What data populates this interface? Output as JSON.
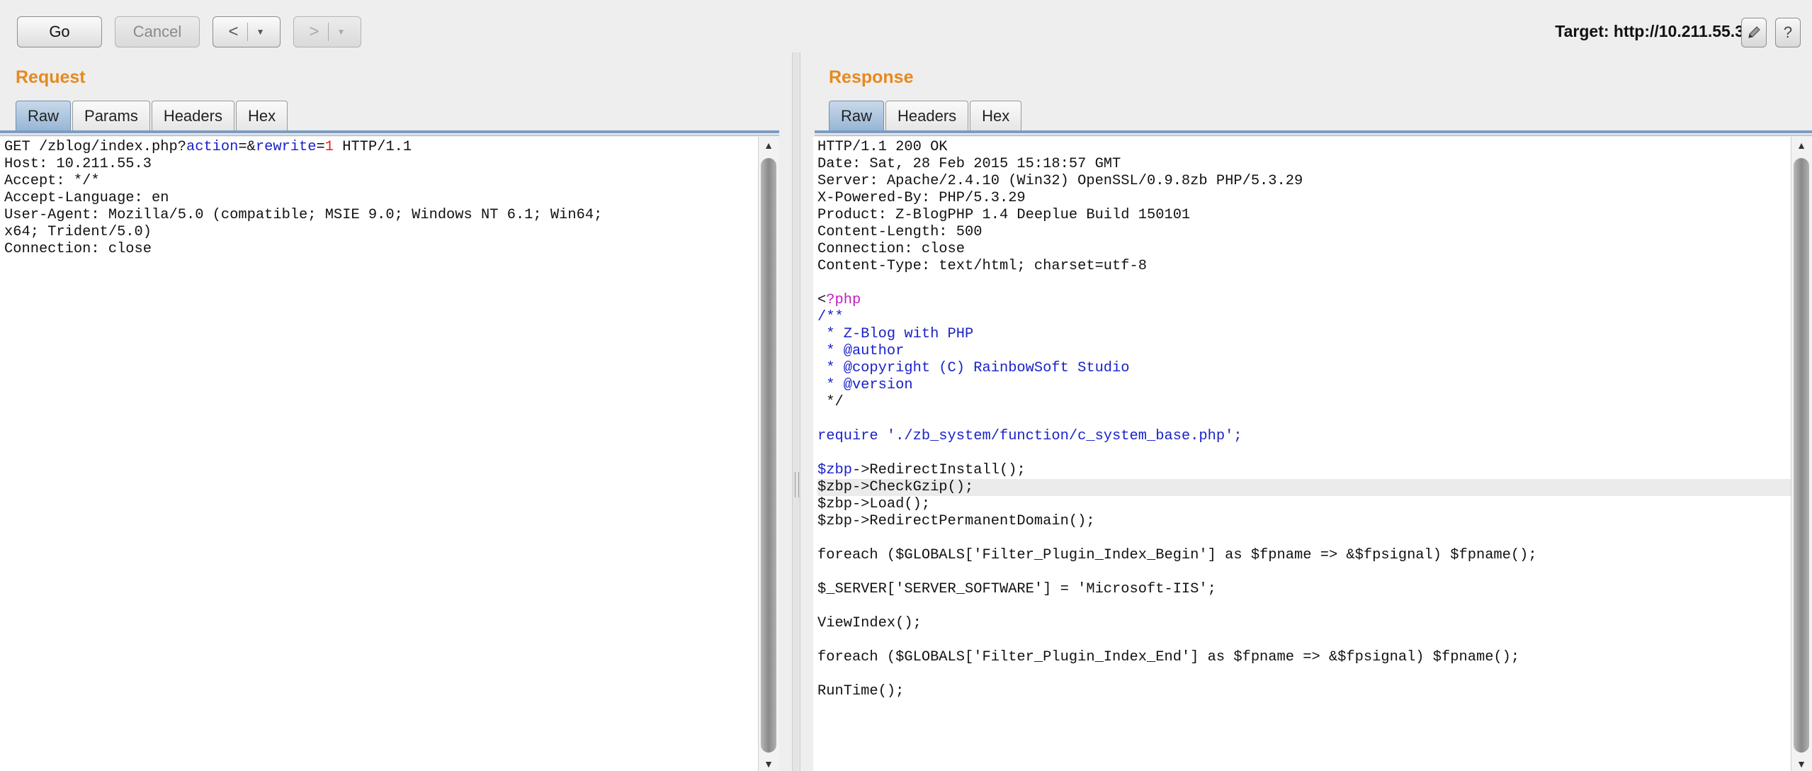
{
  "toolbar": {
    "go_label": "Go",
    "cancel_label": "Cancel",
    "back_arrow": "<",
    "forward_arrow": ">",
    "dropdown_caret": "▼",
    "target_text": "Target: http://10.211.55.3",
    "edit_icon": "pencil-icon",
    "help_label": "?"
  },
  "request": {
    "title": "Request",
    "tabs": [
      "Raw",
      "Params",
      "Headers",
      "Hex"
    ],
    "active_tab": "Raw",
    "lines": [
      [
        {
          "t": "GET /zblog/index.php?"
        },
        {
          "t": "action",
          "c": "kw-blue"
        },
        {
          "t": "=&"
        },
        {
          "t": "rewrite",
          "c": "kw-blue"
        },
        {
          "t": "="
        },
        {
          "t": "1",
          "c": "kw-red"
        },
        {
          "t": " HTTP/1.1"
        }
      ],
      [
        {
          "t": "Host: 10.211.55.3"
        }
      ],
      [
        {
          "t": "Accept: */*"
        }
      ],
      [
        {
          "t": "Accept-Language: en"
        }
      ],
      [
        {
          "t": "User-Agent: Mozilla/5.0 (compatible; MSIE 9.0; Windows NT 6.1; Win64;"
        }
      ],
      [
        {
          "t": "x64; Trident/5.0)"
        }
      ],
      [
        {
          "t": "Connection: close"
        }
      ]
    ]
  },
  "response": {
    "title": "Response",
    "tabs": [
      "Raw",
      "Headers",
      "Hex"
    ],
    "active_tab": "Raw",
    "highlight_line": 20,
    "lines": [
      [
        {
          "t": "HTTP/1.1 200 OK"
        }
      ],
      [
        {
          "t": "Date: Sat, 28 Feb 2015 15:18:57 GMT"
        }
      ],
      [
        {
          "t": "Server: Apache/2.4.10 (Win32) OpenSSL/0.9.8zb PHP/5.3.29"
        }
      ],
      [
        {
          "t": "X-Powered-By: PHP/5.3.29"
        }
      ],
      [
        {
          "t": "Product: Z-BlogPHP 1.4 Deeplue Build 150101"
        }
      ],
      [
        {
          "t": "Content-Length: 500"
        }
      ],
      [
        {
          "t": "Connection: close"
        }
      ],
      [
        {
          "t": "Content-Type: text/html; charset=utf-8"
        }
      ],
      [
        {
          "t": ""
        }
      ],
      [
        {
          "t": "<"
        },
        {
          "t": "?php",
          "c": "kw-mag"
        }
      ],
      [
        {
          "t": "/**",
          "c": "kw-blue"
        }
      ],
      [
        {
          "t": " * Z-Blog with PHP",
          "c": "kw-blue"
        }
      ],
      [
        {
          "t": " * @author",
          "c": "kw-blue"
        }
      ],
      [
        {
          "t": " * @copyright (C) RainbowSoft Studio",
          "c": "kw-blue"
        }
      ],
      [
        {
          "t": " * @version",
          "c": "kw-blue"
        }
      ],
      [
        {
          "t": " */"
        }
      ],
      [
        {
          "t": ""
        }
      ],
      [
        {
          "t": "require './zb_system/function/c_system_base.php';",
          "c": "kw-blue"
        }
      ],
      [
        {
          "t": ""
        }
      ],
      [
        {
          "t": "$zbp",
          "c": "kw-blue"
        },
        {
          "t": "->RedirectInstall();"
        }
      ],
      [
        {
          "t": "$zbp->CheckGzip();"
        }
      ],
      [
        {
          "t": "$zbp->Load();"
        }
      ],
      [
        {
          "t": "$zbp->RedirectPermanentDomain();"
        }
      ],
      [
        {
          "t": ""
        }
      ],
      [
        {
          "t": "foreach ($GLOBALS['Filter_Plugin_Index_Begin'] as $fpname => &$fpsignal) $fpname();"
        }
      ],
      [
        {
          "t": ""
        }
      ],
      [
        {
          "t": "$_SERVER['SERVER_SOFTWARE'] = 'Microsoft-IIS';"
        }
      ],
      [
        {
          "t": ""
        }
      ],
      [
        {
          "t": "ViewIndex();"
        }
      ],
      [
        {
          "t": ""
        }
      ],
      [
        {
          "t": "foreach ($GLOBALS['Filter_Plugin_Index_End'] as $fpname => &$fpsignal) $fpname();"
        }
      ],
      [
        {
          "t": ""
        }
      ],
      [
        {
          "t": "RunTime();"
        }
      ]
    ]
  },
  "scrollbar": {
    "up_arrow": "▲",
    "down_arrow": "▼"
  }
}
